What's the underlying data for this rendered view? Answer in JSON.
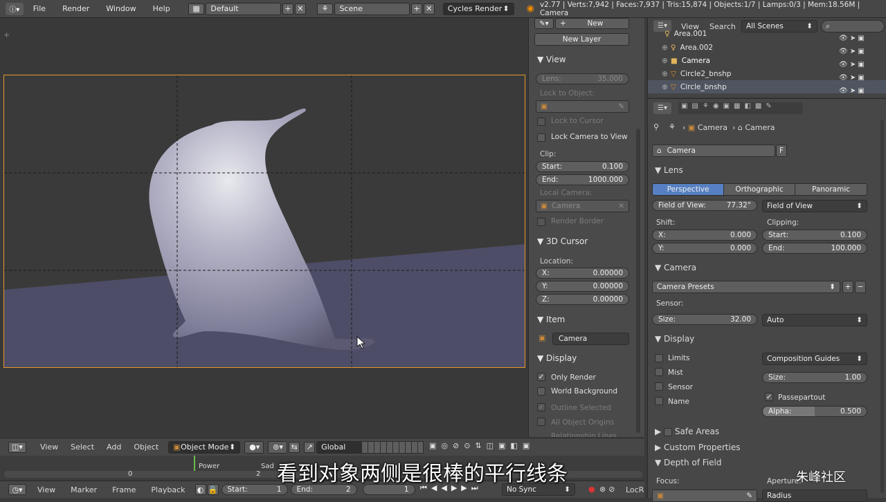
{
  "header": {
    "menus": [
      "File",
      "Render",
      "Window",
      "Help"
    ],
    "layout": "Default",
    "scene": "Scene",
    "engine": "Cycles Render",
    "stats": "v2.77 | Verts:7,942 | Faces:7,937 | Tris:15,874 | Objects:1/7 | Lamps:0/3 | Mem:18.56M | Camera"
  },
  "npanel": {
    "new_label": "New",
    "new_layer": "New Layer",
    "view_title": "View",
    "lens_label": "Lens:",
    "lens_value": "35.000",
    "lock_to_object": "Lock to Object:",
    "lock_to_cursor": "Lock to Cursor",
    "lock_camera_to_view": "Lock Camera to View",
    "clip_label": "Clip:",
    "clip_start_label": "Start:",
    "clip_start_value": "0.100",
    "clip_end_label": "End:",
    "clip_end_value": "1000.000",
    "local_camera": "Local Camera:",
    "local_camera_value": "Camera",
    "render_border": "Render Border",
    "cursor_title": "3D Cursor",
    "location_label": "Location:",
    "x_label": "X:",
    "x_value": "0.00000",
    "y_label": "Y:",
    "y_value": "0.00000",
    "z_label": "Z:",
    "z_value": "0.00000",
    "item_title": "Item",
    "item_name": "Camera",
    "display_title": "Display",
    "only_render": "Only Render",
    "world_background": "World Background",
    "outline_selected": "Outline Selected",
    "all_object_origins": "All Object Origins",
    "relationship_lines": "Relationship Lines"
  },
  "outliner": {
    "view_label": "View",
    "search_label": "Search",
    "scenes_value": "All Scenes",
    "rows": [
      "Area.001",
      "Area.002",
      "Camera",
      "Circle2_bnshp",
      "Circle_bnshp"
    ]
  },
  "props": {
    "breadcrumb_1": "Camera",
    "breadcrumb_2": "Camera",
    "datablock": "Camera",
    "fake_user": "F",
    "lens_title": "Lens",
    "perspective": "Perspective",
    "orthographic": "Orthographic",
    "panoramic": "Panoramic",
    "fov_label": "Field of View:",
    "fov_value": "77.32°",
    "fov_mode": "Field of View",
    "shift_label": "Shift:",
    "clipping_label": "Clipping:",
    "shift_x_label": "X:",
    "shift_x_value": "0.000",
    "shift_y_label": "Y:",
    "shift_y_value": "0.000",
    "clip_start_label": "Start:",
    "clip_start_value": "0.100",
    "clip_end_label": "End:",
    "clip_end_value": "100.000",
    "camera_title": "Camera",
    "camera_presets": "Camera Presets",
    "sensor_label": "Sensor:",
    "size_label": "Size:",
    "size_value": "32.00",
    "sensor_fit": "Auto",
    "display_title": "Display",
    "limits": "Limits",
    "mist": "Mist",
    "sensor": "Sensor",
    "name": "Name",
    "composition_guides": "Composition Guides",
    "disp_size_label": "Size:",
    "disp_size_value": "1.00",
    "passepartout": "Passepartout",
    "alpha_label": "Alpha:",
    "alpha_value": "0.500",
    "alpha_fraction": 0.5,
    "safe_areas": "Safe Areas",
    "custom_properties": "Custom Properties",
    "depth_of_field": "Depth of Field",
    "focus_label": "Focus:",
    "aperture_label": "Aperture:",
    "radius_value": "Radius"
  },
  "viewheader": {
    "view": "View",
    "select": "Select",
    "add": "Add",
    "object": "Object",
    "mode": "Object Mode",
    "orientation": "Global"
  },
  "timeline": {
    "frame_0": "0",
    "frame_2": "2",
    "power_marker": "Power",
    "sad_marker": "Sad"
  },
  "timebar": {
    "view": "View",
    "marker": "Marker",
    "frame": "Frame",
    "playback": "Playback",
    "start_label": "Start:",
    "start_value": "1",
    "end_label": "End:",
    "end_value": "2",
    "current": "1",
    "sync": "No Sync",
    "locked": "LocR"
  },
  "subtitle": "看到对象两侧是很棒的平行线条",
  "watermark": "朱峰社区",
  "colors": {
    "accent": "#5680c2",
    "camera_frame": "#e39a2c"
  }
}
